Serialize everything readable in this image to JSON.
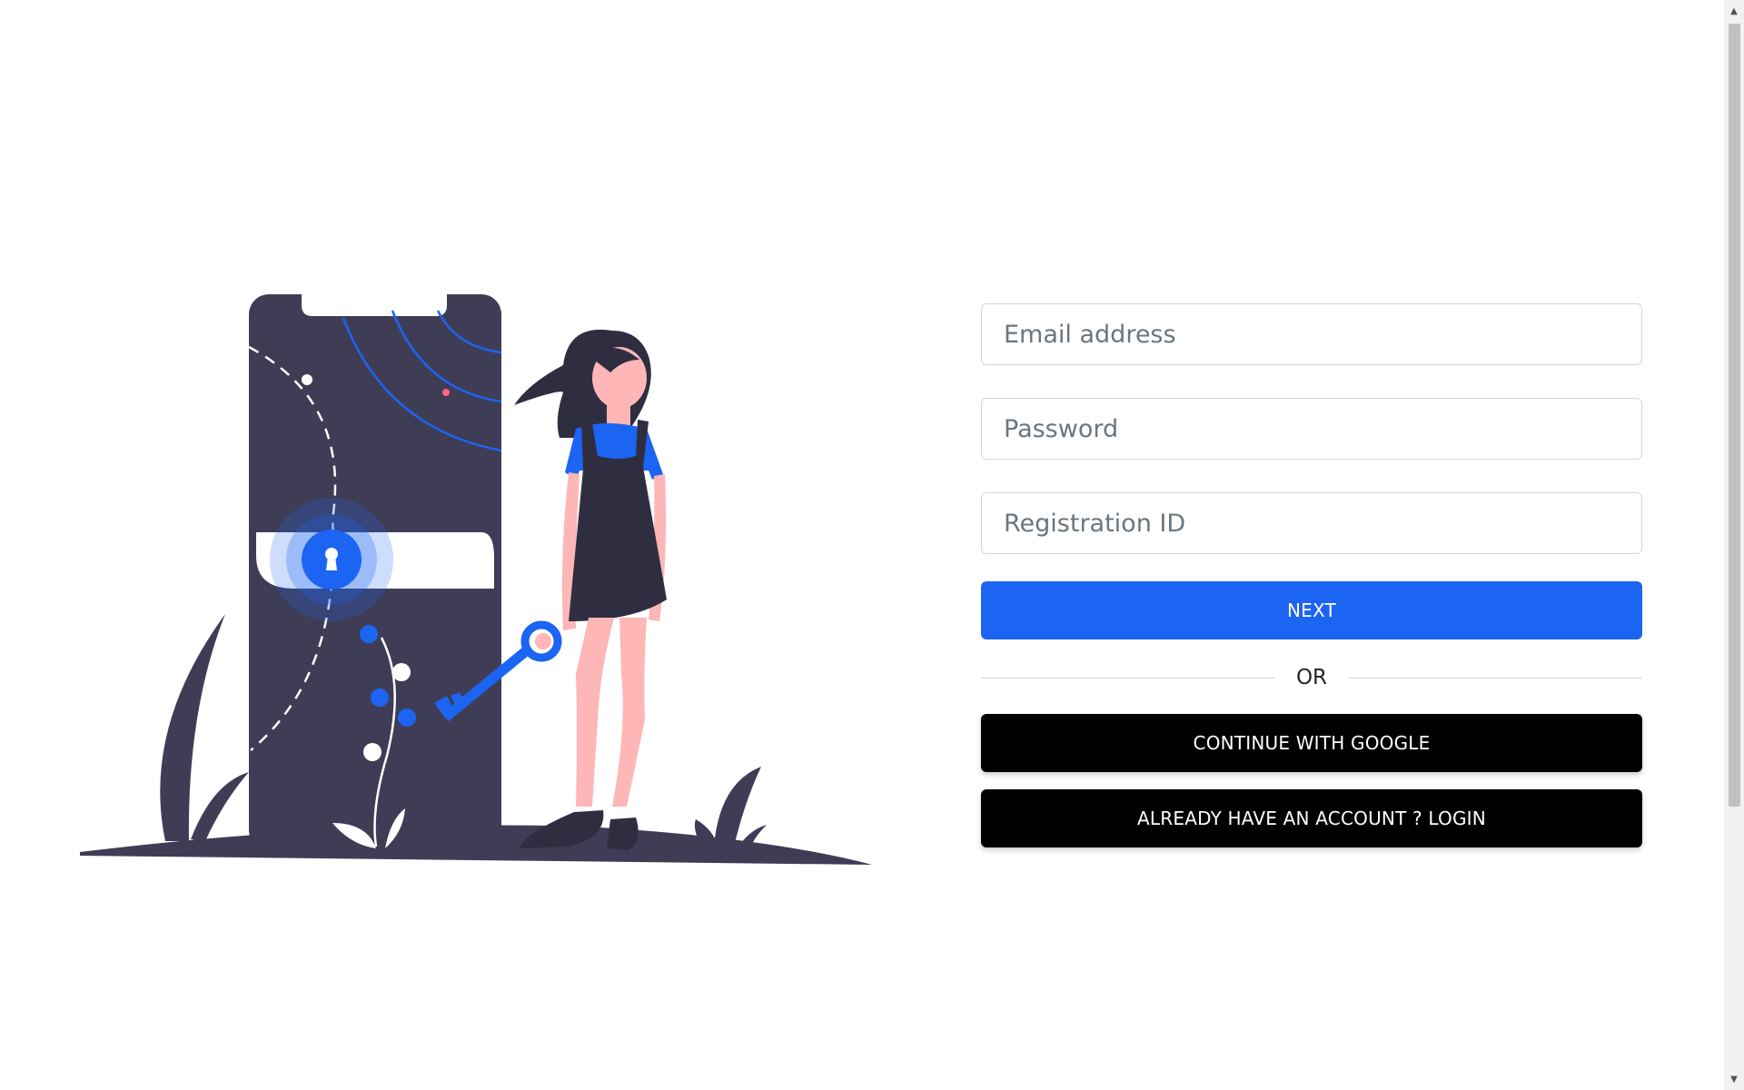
{
  "form": {
    "email_placeholder": "Email address",
    "password_placeholder": "Password",
    "registration_placeholder": "Registration ID",
    "next_label": "NEXT",
    "divider_label": "OR",
    "google_label": "CONTINUE WITH GOOGLE",
    "login_label": "ALREADY HAVE AN ACCOUNT ? LOGIN"
  },
  "illustration": {
    "subject": "woman holding key next to phone with lock"
  },
  "icons": {
    "scroll_up": "scroll-up-icon",
    "scroll_down": "scroll-down-icon"
  },
  "colors": {
    "primary": "#1c64f2",
    "dark": "#000000",
    "illustration_dark": "#3f3d56",
    "skin": "#ffb6b6"
  }
}
